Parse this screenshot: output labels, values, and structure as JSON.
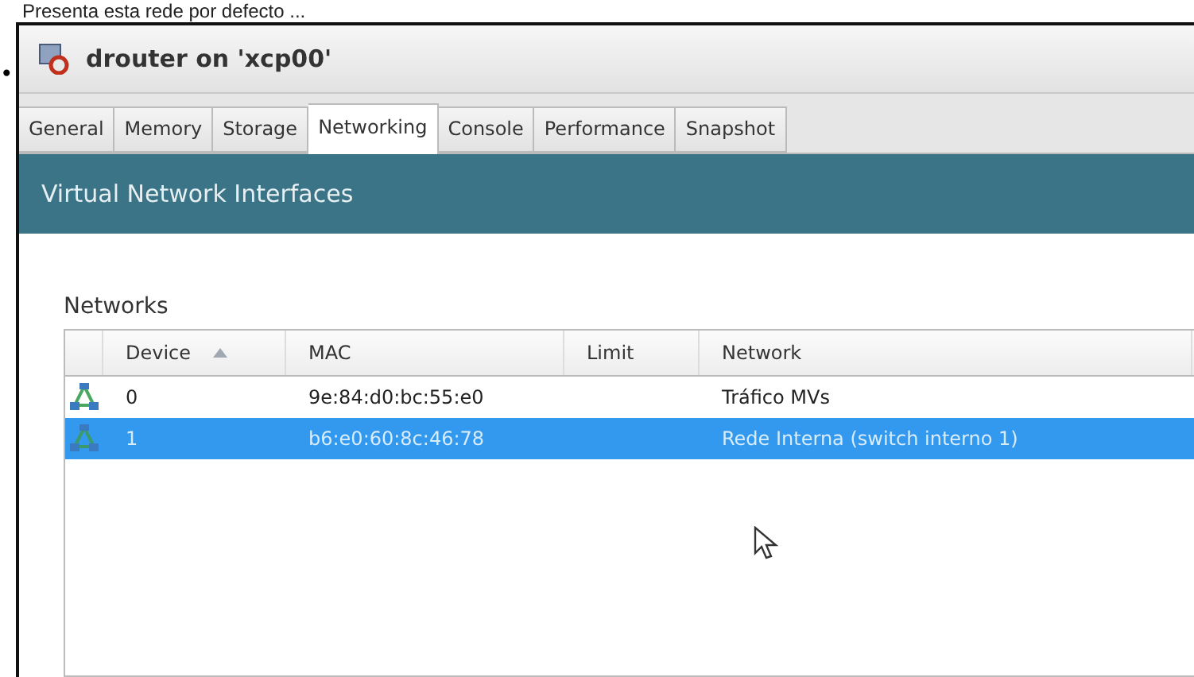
{
  "caption": "Presenta esta rede por defecto ...",
  "bullet": "•",
  "window": {
    "title": "drouter on 'xcp00'"
  },
  "tabs": [
    {
      "label": "General",
      "selected": false
    },
    {
      "label": "Memory",
      "selected": false
    },
    {
      "label": "Storage",
      "selected": false
    },
    {
      "label": "Networking",
      "selected": true
    },
    {
      "label": "Console",
      "selected": false
    },
    {
      "label": "Performance",
      "selected": false
    },
    {
      "label": "Snapshot",
      "selected": false
    }
  ],
  "banner": "Virtual Network Interfaces",
  "section": "Networks",
  "table": {
    "columns": [
      {
        "label": "Device",
        "sorted": true
      },
      {
        "label": "MAC",
        "sorted": false
      },
      {
        "label": "Limit",
        "sorted": false
      },
      {
        "label": "Network",
        "sorted": false
      }
    ],
    "rows": [
      {
        "device": "0",
        "mac": "9e:84:d0:bc:55:e0",
        "network": "Tráfico MVs",
        "selected": false
      },
      {
        "device": "1",
        "mac": "b6:e0:60:8c:46:78",
        "network": "Rede Interna (switch interno 1)",
        "selected": true
      }
    ]
  }
}
